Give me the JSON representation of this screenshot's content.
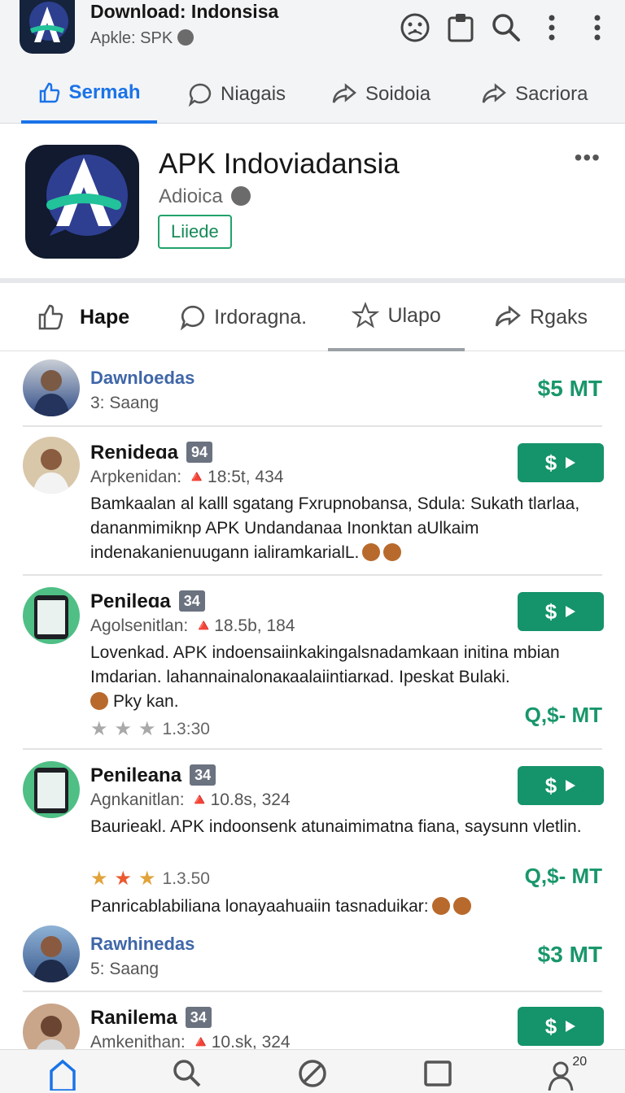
{
  "header": {
    "title": "Download: Indonsisa",
    "subtitle": "Apkle:  SPK",
    "icon": "app-logo-a"
  },
  "top_actions": [
    "emoji-icon",
    "clipboard-icon",
    "search-icon",
    "more-vert-icon",
    "more-vert-icon"
  ],
  "tabs_top": [
    {
      "label": "Sermah",
      "icon": "thumbs-up-icon",
      "active": true
    },
    {
      "label": "Niagais",
      "icon": "chat-icon",
      "active": false
    },
    {
      "label": "Soidoia",
      "icon": "share-icon",
      "active": false
    },
    {
      "label": "Sacriora",
      "icon": "share-icon",
      "active": false
    }
  ],
  "app": {
    "name": "APK Indoviadansia",
    "developer": "Adioica",
    "badge": "Liiede",
    "more": "•••"
  },
  "tabs_second": [
    {
      "label": "Hape",
      "icon": "thumbs-up-icon"
    },
    {
      "label": "Irdoragna.",
      "icon": "chat-icon"
    },
    {
      "label": "Ulapo",
      "icon": "star-icon"
    },
    {
      "label": "Rgaks",
      "icon": "share-icon"
    }
  ],
  "list": [
    {
      "type": "compact",
      "title": "Dawnloedas",
      "sub": "3: Saang",
      "price": "$5 MT"
    },
    {
      "type": "review",
      "name": "Renideɑa",
      "count": "94",
      "meta": "Arpkenidan: 🔺18:5t, 434",
      "text": "Bamkaalan al kalll sgatang Fxrupnobansa, Sdula: Sukath tlarlaa, dananmimiknp APK Undandanaa Inonktan aUlkaim indenakanienuugann ialiramkarialL.",
      "btn": "$"
    },
    {
      "type": "review",
      "name": "Penileɑa",
      "count": "34",
      "meta": "Agolsenitlan: 🔺18.5b, 184",
      "text": "Lovenkad. APK indoensaiinkakingalsnadamkaan initina mbian Imdarian. lahannainalonaкaalaiintiarкad. Ipeskat Bulaki.",
      "extra": "Pky kan.",
      "rating": "1.3:30",
      "stars": [
        "grey",
        "grey",
        "grey"
      ],
      "price": "Q,$- MT",
      "btn": "$"
    },
    {
      "type": "review",
      "name": "Penileana",
      "count": "34",
      "meta": "Agnkanitlan: 🔺10.8s, 324",
      "text": "Baurieakl. APK indoonsenk atunaimimatna fiana, saysunn vletlin.",
      "rating": "1.3.50",
      "stars": [
        "gold",
        "red",
        "gold"
      ],
      "price": "Q,$- MT",
      "btn": "$",
      "footer": "Panricablabiliana lonayaahuaiin tasnaduikar:"
    },
    {
      "type": "compact",
      "title": "Rawhinedas",
      "sub": "5: Saang",
      "price": "$3 MT"
    },
    {
      "type": "review",
      "name": "Ranilema",
      "count": "34",
      "meta": "Amkenithan: 🔺10.sk, 324",
      "btn": "$"
    }
  ],
  "bottom_nav": [
    {
      "icon": "home-icon"
    },
    {
      "icon": "search-icon"
    },
    {
      "icon": "block-icon"
    },
    {
      "icon": "square-icon"
    },
    {
      "icon": "account-icon",
      "count": "20"
    }
  ],
  "colors": {
    "accent": "#1a73e8",
    "green": "#15936a",
    "link": "#3f66a8"
  }
}
